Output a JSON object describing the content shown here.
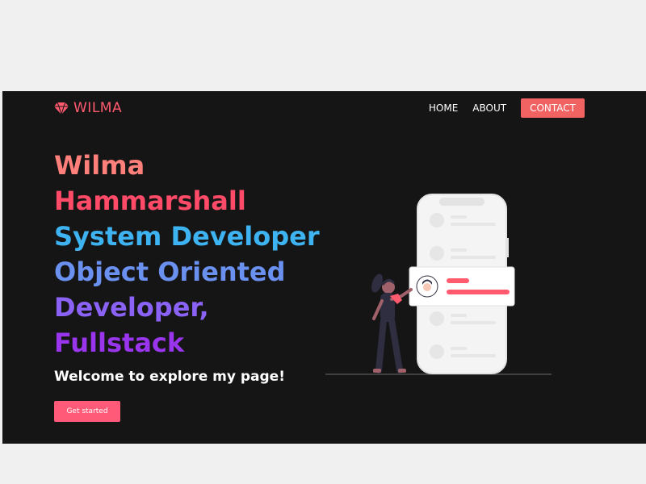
{
  "brand": {
    "name": "WILMA",
    "icon": "diamond-icon",
    "color": "#ff5a6e"
  },
  "nav": {
    "home": "HOME",
    "about": "ABOUT",
    "contact": "CONTACT"
  },
  "hero": {
    "lines": [
      "Wilma",
      "Hammarshall",
      "System Developer",
      "Object Oriented",
      "Developer,",
      "Fullstack"
    ],
    "welcome": "Welcome to explore my page!",
    "cta": "Get started"
  },
  "colors": {
    "background": "#161516",
    "accent": "#f16262"
  }
}
